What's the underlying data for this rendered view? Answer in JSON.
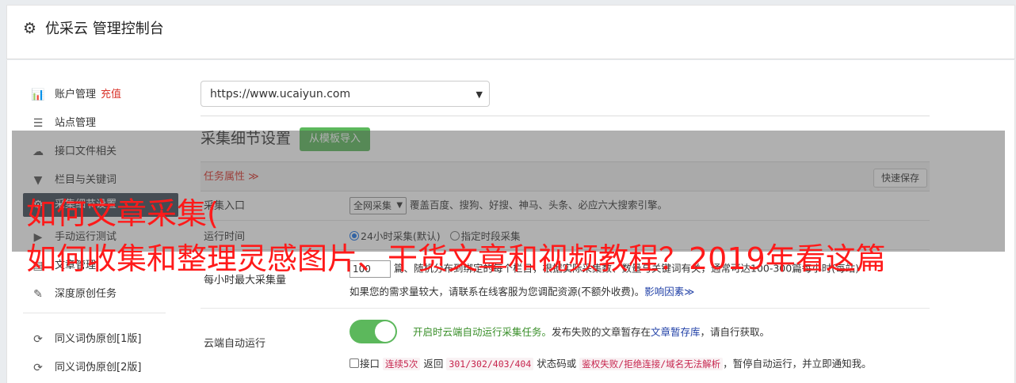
{
  "header": {
    "title": "优采云 管理控制台",
    "icon": "gear-icon"
  },
  "sidebar": {
    "items": [
      {
        "label": "账户管理",
        "extra": "充值",
        "icon": "bar-chart-icon"
      },
      {
        "label": "站点管理",
        "icon": "server-icon"
      },
      {
        "label": "接口文件相关",
        "icon": "cloud-upload-icon"
      },
      {
        "label": "栏目与关键词",
        "icon": "filter-icon"
      },
      {
        "label": "采集细节设置",
        "icon": "cog-icon",
        "active": true
      },
      {
        "label": "手动运行测试",
        "icon": "play-circle-icon"
      },
      {
        "label": "文章管理",
        "icon": "file-icon"
      },
      {
        "label": "深度原创任务",
        "icon": "edit-icon"
      },
      {
        "label": "同义词伪原创[1版]",
        "icon": "refresh-icon"
      },
      {
        "label": "同义词伪原创[2版]",
        "icon": "refresh-icon"
      }
    ]
  },
  "main": {
    "site_select": "https://www.ucaiyun.com",
    "section_title": "采集细节设置",
    "import_button": "从模板导入",
    "task_attr_label": "任务属性",
    "task_attr_caret": "≫",
    "quick_save": "快速保存",
    "rows": {
      "entry": {
        "label": "采集入口",
        "select_value": "全网采集",
        "desc": "覆盖百度、搜狗、好搜、神马、头条、必应六大搜索引擎。"
      },
      "runtime": {
        "label": "运行时间",
        "option1": "24小时采集(默认)",
        "option2": "指定时段采集"
      },
      "max": {
        "label": "每小时最大采集量",
        "input_value": "100",
        "line1": "篇、随机分布到绑定的每个栏目，根据实际采集数、数量与关键词有关，通常可达100-300篇每小时(每站)",
        "line2": "如果您的需求量较大，请联系在线客服为您调配资源(不额外收费)。",
        "link": "影响因素",
        "link_caret": "≫"
      },
      "cloud": {
        "label": "云端自动运行",
        "line1_green": "开启时云端自动运行采集任务。",
        "line1_rest": "发布失败的文章暂存在",
        "line1_link": "文章暂存库",
        "line1_tail": "，请自行获取。",
        "line2_a": "接口",
        "line2_code1": "连续5次",
        "line2_b": "返回",
        "line2_code2": "301/302/403/404",
        "line2_c": "状态码或",
        "line2_code3": "鉴权失败/拒绝连接/域名无法解析",
        "line2_d": "，暂停自动运行，并立即通知我。"
      }
    }
  },
  "watermark": {
    "line1": "如何文章采集(",
    "line2": "如何收集和整理灵感图片、干货文章和视频教程？2019年看这篇"
  }
}
